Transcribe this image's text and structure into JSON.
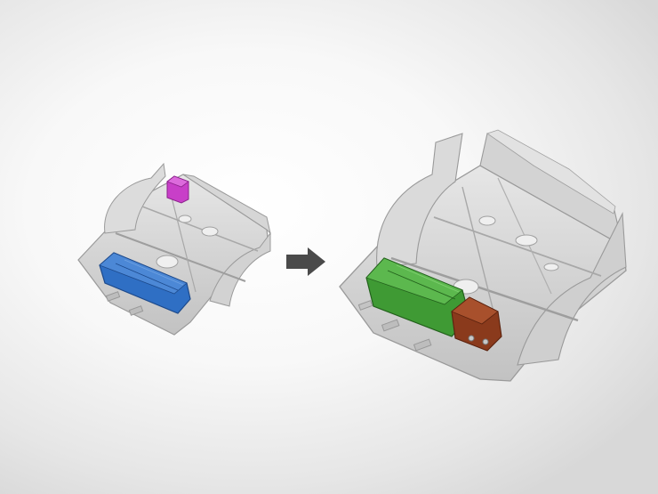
{
  "diagram": {
    "before": {
      "components": [
        {
          "name": "battery",
          "color": "#2f6fc4"
        },
        {
          "name": "auxiliary-box",
          "color": "#c83fc8"
        }
      ]
    },
    "after": {
      "components": [
        {
          "name": "battery",
          "color": "#3f9a34"
        },
        {
          "name": "electronics-module",
          "color": "#8a3a1c"
        }
      ]
    },
    "arrow": {
      "direction": "right",
      "color": "#4a4a4a"
    },
    "frame_color": "#c9c9c9"
  }
}
